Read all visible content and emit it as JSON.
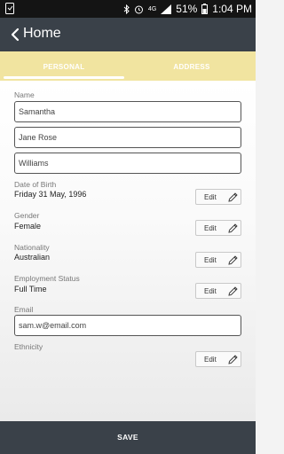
{
  "status_bar": {
    "signal_label": "4G",
    "battery": "51%",
    "time": "1:04 PM",
    "icons": [
      "notification-icon",
      "bluetooth-icon",
      "alarm-icon",
      "signal-icon",
      "battery-icon"
    ]
  },
  "app_bar": {
    "title": "Home",
    "back_icon": "chevron-left-icon"
  },
  "tabs": [
    {
      "label": "PERSONAL",
      "selected": true
    },
    {
      "label": "ADDRESS",
      "selected": false
    }
  ],
  "form": {
    "name": {
      "label": "Name",
      "first": "Samantha",
      "middle": "Jane Rose",
      "last": "Williams"
    },
    "dob": {
      "label": "Date of Birth",
      "value": "Friday 31 May, 1996"
    },
    "gender": {
      "label": "Gender",
      "value": "Female"
    },
    "nationality": {
      "label": "Nationality",
      "value": "Australian"
    },
    "employment": {
      "label": "Employment Status",
      "value": "Full Time"
    },
    "email": {
      "label": "Email",
      "value": "sam.w@email.com"
    },
    "ethnicity": {
      "label": "Ethnicity",
      "value": ""
    },
    "edit_label": "Edit"
  },
  "save_label": "SAVE",
  "colors": {
    "app_bar": "#3a4149",
    "tab_bar": "#f1e4a0",
    "status_bar": "#141414"
  }
}
